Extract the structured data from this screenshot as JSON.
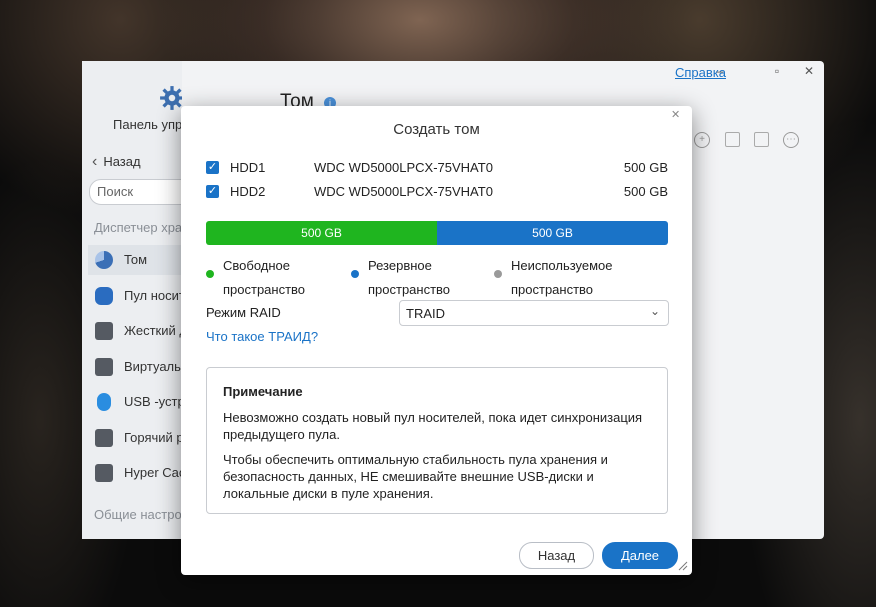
{
  "app": {
    "sidebar": {
      "control_panel_label": "Панель упр",
      "back_label": "Назад",
      "search_placeholder": "Поиск",
      "section_storage": "Диспетчер хра",
      "items": [
        {
          "label": "Том",
          "icon": "pie-chart-icon",
          "color": "#3b6fb6"
        },
        {
          "label": "Пул носит",
          "icon": "database-icon",
          "color": "#2a6cc0"
        },
        {
          "label": "Жесткий д",
          "icon": "hard-disk-icon",
          "color": "#555a62"
        },
        {
          "label": "Виртуальн",
          "icon": "virtual-disk-icon",
          "color": "#555a62"
        },
        {
          "label": "USB -устр",
          "icon": "usb-icon",
          "color": "#2a8de0"
        },
        {
          "label": "Горячий р",
          "icon": "hot-spare-icon",
          "color": "#555a62"
        },
        {
          "label": "Hyper Cach",
          "icon": "cache-icon",
          "color": "#555a62"
        }
      ],
      "section_general": "Общие настро"
    },
    "title": "Том",
    "help_link": "Справка"
  },
  "dialog": {
    "title": "Создать том",
    "disks": [
      {
        "name": "HDD1",
        "model": "WDC WD5000LPCX-75VHAT0",
        "size": "500 GB",
        "checked": true
      },
      {
        "name": "HDD2",
        "model": "WDC WD5000LPCX-75VHAT0",
        "size": "500 GB",
        "checked": true
      }
    ],
    "capacity_bar": {
      "free": {
        "label": "500 GB",
        "color": "#1fb51f",
        "fraction": 0.5
      },
      "reserve": {
        "label": "500 GB",
        "color": "#1a73c7",
        "fraction": 0.5
      }
    },
    "legend": {
      "free": {
        "line1": "Свободное",
        "line2": "пространство",
        "color": "#1fb51f"
      },
      "reserve": {
        "line1": "Резервное",
        "line2": "пространство",
        "color": "#1a73c7"
      },
      "unused": {
        "line1": "Неиспользуемое",
        "line2": "пространство",
        "color": "#9a9a9a"
      }
    },
    "raid_label": "Режим RAID",
    "raid_value": "TRAID",
    "traid_link": "Что такое ТРАИД?",
    "note": {
      "title": "Примечание",
      "p1": "Невозможно создать новый пул носителей, пока идет синхронизация предыдущего пула.",
      "p2": "Чтобы обеспечить оптимальную стабильность пула хранения и безопасность данных, НЕ смешивайте внешние USB-диски и локальные диски в пуле хранения."
    },
    "back_button": "Назад",
    "next_button": "Далее"
  }
}
